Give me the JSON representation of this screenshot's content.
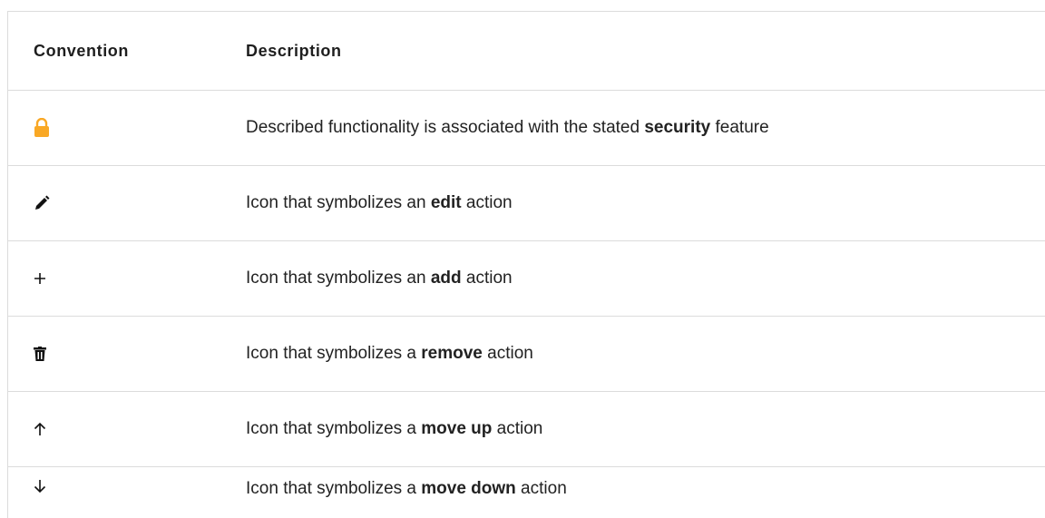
{
  "table": {
    "headers": {
      "convention": "Convention",
      "description": "Description"
    },
    "rows": [
      {
        "icon": "lock-icon",
        "icon_color": "#f9a825",
        "pre": "Described functionality is associated with the stated ",
        "bold": "security",
        "post": " feature"
      },
      {
        "icon": "pencil-icon",
        "icon_color": "#111111",
        "pre": "Icon that symbolizes an ",
        "bold": "edit",
        "post": " action"
      },
      {
        "icon": "plus-icon",
        "icon_color": "#111111",
        "pre": "Icon that symbolizes an ",
        "bold": "add",
        "post": " action"
      },
      {
        "icon": "trash-icon",
        "icon_color": "#111111",
        "pre": "Icon that symbolizes a ",
        "bold": "remove",
        "post": " action"
      },
      {
        "icon": "arrow-up-icon",
        "icon_color": "#111111",
        "pre": "Icon that symbolizes a ",
        "bold": "move up",
        "post": " action"
      },
      {
        "icon": "arrow-down-icon",
        "icon_color": "#111111",
        "pre": "Icon that symbolizes a ",
        "bold": "move down",
        "post": " action"
      }
    ]
  }
}
